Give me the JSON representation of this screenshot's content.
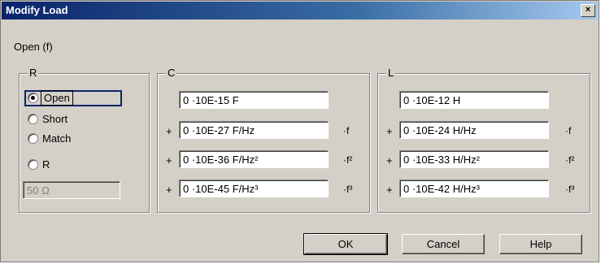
{
  "window": {
    "title": "Modify Load",
    "close_glyph": "×"
  },
  "subtitle": "Open (f)",
  "r_group": {
    "label": "R",
    "radios": [
      {
        "label": "Open",
        "checked": true
      },
      {
        "label": "Short",
        "checked": false
      },
      {
        "label": "Match",
        "checked": false
      },
      {
        "label": "R",
        "checked": false
      }
    ],
    "resistance_value": "50 Ω"
  },
  "c_group": {
    "label": "C",
    "rows": [
      {
        "prefix": "",
        "value": "0 ·10E-15 F",
        "suffix": ""
      },
      {
        "prefix": "+",
        "value": "0 ·10E-27 F/Hz",
        "suffix": "·f"
      },
      {
        "prefix": "+",
        "value": "0 ·10E-36 F/Hz²",
        "suffix": "·f²"
      },
      {
        "prefix": "+",
        "value": "0 ·10E-45 F/Hz³",
        "suffix": "·f³"
      }
    ]
  },
  "l_group": {
    "label": "L",
    "rows": [
      {
        "prefix": "",
        "value": "0 ·10E-12 H",
        "suffix": ""
      },
      {
        "prefix": "+",
        "value": "0 ·10E-24 H/Hz",
        "suffix": "·f"
      },
      {
        "prefix": "+",
        "value": "0 ·10E-33 H/Hz²",
        "suffix": "·f²"
      },
      {
        "prefix": "+",
        "value": "0 ·10E-42 H/Hz³",
        "suffix": "·f³"
      }
    ]
  },
  "buttons": {
    "ok": "OK",
    "cancel": "Cancel",
    "help": "Help"
  }
}
